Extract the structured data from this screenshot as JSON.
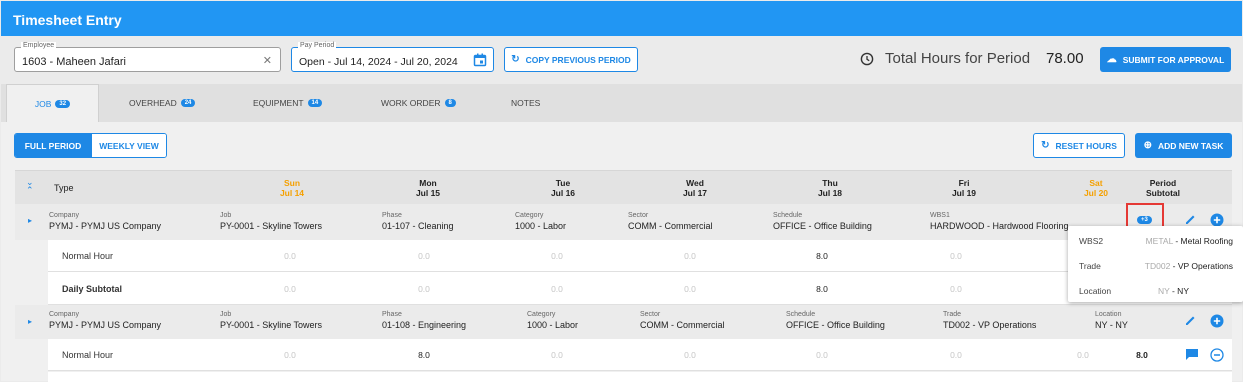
{
  "title": "Timesheet Entry",
  "employee": {
    "label": "Employee",
    "value": "1603 - Maheen Jafari"
  },
  "pay_period": {
    "label": "Pay Period",
    "value": "Open - Jul 14, 2024 - Jul 20, 2024"
  },
  "copy_previous_label": "COPY PREVIOUS PERIOD",
  "total_hours_label": "Total Hours for Period",
  "total_hours_value": "78.00",
  "submit_label": "SUBMIT FOR APPROVAL",
  "tabs": [
    {
      "label": "JOB",
      "count": "32"
    },
    {
      "label": "OVERHEAD",
      "count": "24"
    },
    {
      "label": "EQUIPMENT",
      "count": "14"
    },
    {
      "label": "WORK ORDER",
      "count": "8"
    },
    {
      "label": "NOTES",
      "count": ""
    }
  ],
  "view_toggle": {
    "full": "FULL PERIOD",
    "weekly": "WEEKLY VIEW"
  },
  "reset_hours_label": "RESET HOURS",
  "add_task_label": "ADD NEW TASK",
  "table_header": {
    "type": "Type",
    "days": [
      {
        "day": "Sun",
        "date": "Jul 14"
      },
      {
        "day": "Mon",
        "date": "Jul 15"
      },
      {
        "day": "Tue",
        "date": "Jul 16"
      },
      {
        "day": "Wed",
        "date": "Jul 17"
      },
      {
        "day": "Thu",
        "date": "Jul 18"
      },
      {
        "day": "Fri",
        "date": "Jul 19"
      },
      {
        "day": "Sat",
        "date": "Jul 20"
      }
    ],
    "subtotal": "Period",
    "subtotal2": "Subtotal"
  },
  "group1": {
    "fields": [
      {
        "k": "Company",
        "v": "PYMJ - PYMJ US Company"
      },
      {
        "k": "Job",
        "v": "PY-0001 - Skyline Towers"
      },
      {
        "k": "Phase",
        "v": "01-107 - Cleaning"
      },
      {
        "k": "Category",
        "v": "1000 - Labor"
      },
      {
        "k": "Sector",
        "v": "COMM - Commercial"
      },
      {
        "k": "Schedule",
        "v": "OFFICE - Office Building"
      },
      {
        "k": "WBS1",
        "v": "HARDWOOD - Hardwood Flooring"
      }
    ],
    "more_badge": "+3",
    "rows": [
      {
        "label": "Normal Hour",
        "values": [
          "0.0",
          "0.0",
          "0.0",
          "0.0",
          "8.0",
          "0.0",
          "0.0"
        ]
      },
      {
        "label": "Daily Subtotal",
        "values": [
          "0.0",
          "0.0",
          "0.0",
          "0.0",
          "8.0",
          "0.0",
          "0.0"
        ]
      }
    ]
  },
  "popup": [
    {
      "k": "WBS2",
      "code": "METAL",
      "v": " - Metal Roofing"
    },
    {
      "k": "Trade",
      "code": "TD002",
      "v": " - VP Operations"
    },
    {
      "k": "Location",
      "code": "NY",
      "v": " - NY"
    }
  ],
  "group2": {
    "fields": [
      {
        "k": "Company",
        "v": "PYMJ - PYMJ US Company"
      },
      {
        "k": "Job",
        "v": "PY-0001 - Skyline Towers"
      },
      {
        "k": "Phase",
        "v": "01-108 - Engineering"
      },
      {
        "k": "Category",
        "v": "1000 - Labor"
      },
      {
        "k": "Sector",
        "v": "COMM - Commercial"
      },
      {
        "k": "Schedule",
        "v": "OFFICE - Office Building"
      },
      {
        "k": "Trade",
        "v": "TD002 - VP Operations"
      },
      {
        "k": "Location",
        "v": "NY - NY"
      }
    ],
    "rows": [
      {
        "label": "Normal Hour",
        "values": [
          "0.0",
          "8.0",
          "0.0",
          "0.0",
          "0.0",
          "0.0",
          "0.0"
        ],
        "subtotal": "8.0"
      }
    ]
  },
  "colors": {
    "primary": "#1e88e5",
    "titlebar": "#2196f3",
    "weekend": "#f5a000",
    "highlight": "#e53935"
  }
}
